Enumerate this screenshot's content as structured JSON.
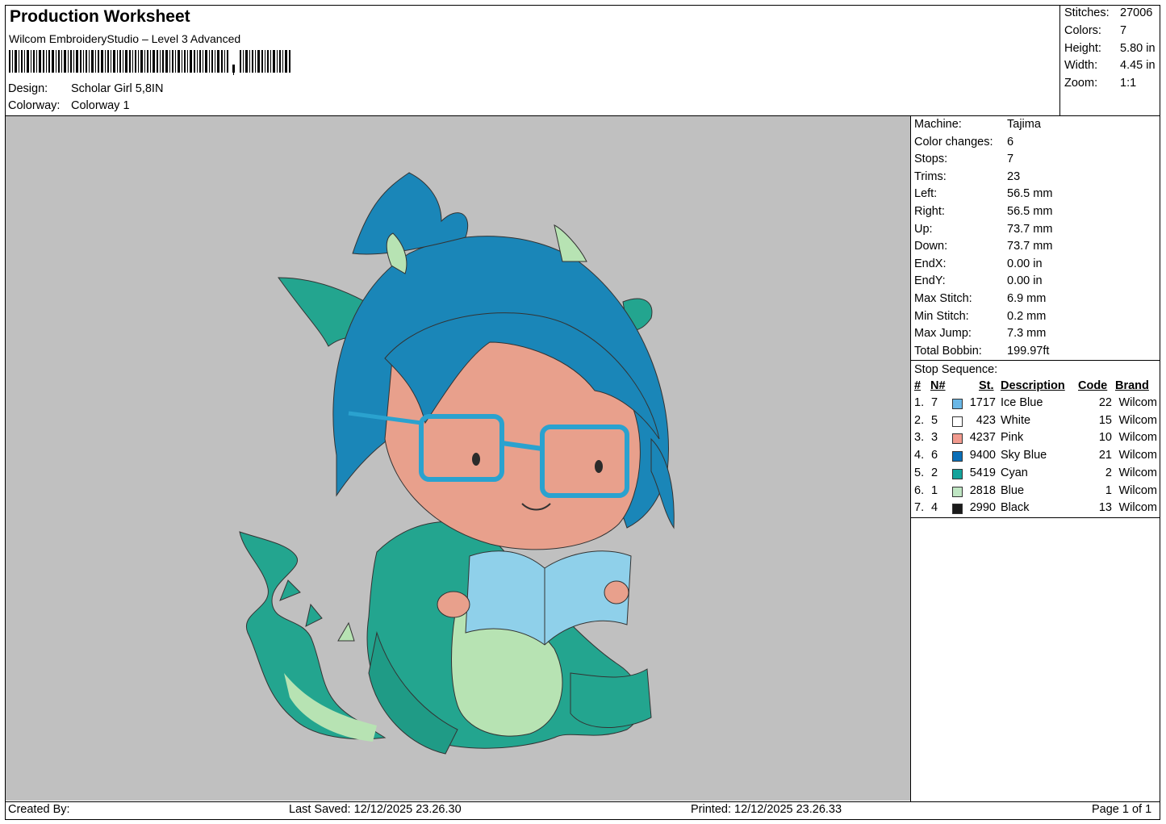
{
  "header": {
    "title": "Production Worksheet",
    "subtitle": "Wilcom EmbroideryStudio – Level 3 Advanced",
    "design_label": "Design:",
    "design_value": "Scholar Girl  5,8IN",
    "colorway_label": "Colorway:",
    "colorway_value": "Colorway 1"
  },
  "summary": {
    "stitches_label": "Stitches:",
    "stitches": "27006",
    "colors_label": "Colors:",
    "colors": "7",
    "height_label": "Height:",
    "height": "5.80 in",
    "width_label": "Width:",
    "width": "4.45 in",
    "zoom_label": "Zoom:",
    "zoom": "1:1"
  },
  "machine_info": [
    {
      "label": "Machine:",
      "value": "Tajima"
    },
    {
      "label": "Color changes:",
      "value": "6"
    },
    {
      "label": "Stops:",
      "value": "7"
    },
    {
      "label": "Trims:",
      "value": "23"
    },
    {
      "label": "Left:",
      "value": "56.5 mm"
    },
    {
      "label": "Right:",
      "value": "56.5 mm"
    },
    {
      "label": "Up:",
      "value": "73.7 mm"
    },
    {
      "label": "Down:",
      "value": "73.7 mm"
    },
    {
      "label": "EndX:",
      "value": "0.00 in"
    },
    {
      "label": "EndY:",
      "value": "0.00 in"
    },
    {
      "label": "Max Stitch:",
      "value": "6.9 mm"
    },
    {
      "label": "Min Stitch:",
      "value": "0.2 mm"
    },
    {
      "label": "Max Jump:",
      "value": "7.3 mm"
    },
    {
      "label": "Total Bobbin:",
      "value": "199.97ft"
    }
  ],
  "stop_sequence": {
    "title": "Stop Sequence:",
    "columns": {
      "idx": "#",
      "n": "N#",
      "st": "St.",
      "desc": "Description",
      "code": "Code",
      "brand": "Brand"
    },
    "rows": [
      {
        "idx": "1.",
        "n": "7",
        "color": "#6ab7e6",
        "st": "1717",
        "desc": "Ice Blue",
        "code": "22",
        "brand": "Wilcom"
      },
      {
        "idx": "2.",
        "n": "5",
        "color": "#ffffff",
        "st": "423",
        "desc": "White",
        "code": "15",
        "brand": "Wilcom"
      },
      {
        "idx": "3.",
        "n": "3",
        "color": "#f19a8e",
        "st": "4237",
        "desc": "Pink",
        "code": "10",
        "brand": "Wilcom"
      },
      {
        "idx": "4.",
        "n": "6",
        "color": "#0a6fb8",
        "st": "9400",
        "desc": "Sky Blue",
        "code": "21",
        "brand": "Wilcom"
      },
      {
        "idx": "5.",
        "n": "2",
        "color": "#14a39b",
        "st": "5419",
        "desc": "Cyan",
        "code": "2",
        "brand": "Wilcom"
      },
      {
        "idx": "6.",
        "n": "1",
        "color": "#bfe6c3",
        "st": "2818",
        "desc": "Blue",
        "code": "1",
        "brand": "Wilcom"
      },
      {
        "idx": "7.",
        "n": "4",
        "color": "#1a1a1a",
        "st": "2990",
        "desc": "Black",
        "code": "13",
        "brand": "Wilcom"
      }
    ]
  },
  "footer": {
    "created_by": "Created By:",
    "last_saved": "Last Saved: 12/12/2025 23.26.30",
    "printed": "Printed: 12/12/2025 23.26.33",
    "page": "Page 1 of 1"
  },
  "design_preview": {
    "subject": "girl-in-dragon-costume-reading-book",
    "hair_color": "#1a86b8",
    "skin_color": "#e8a08c",
    "costume_color": "#23a58f",
    "belly_color": "#b7e3b3",
    "book_color": "#8fd0ea",
    "glasses_color": "#2aa2cf",
    "background": "#c0c0c0"
  }
}
